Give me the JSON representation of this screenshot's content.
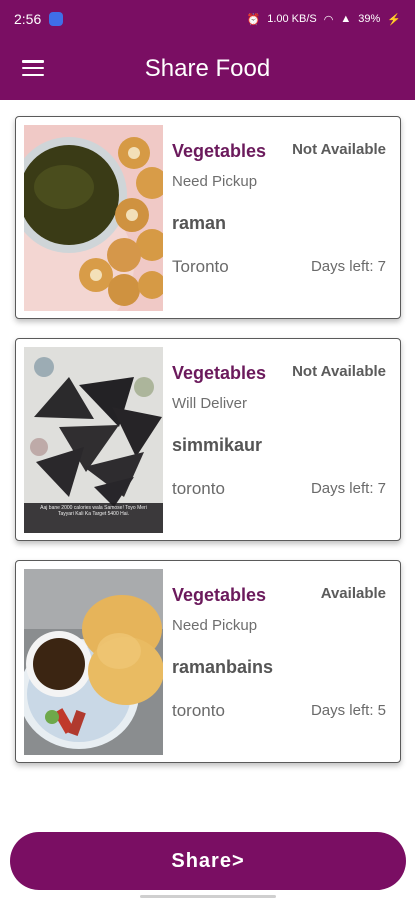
{
  "status": {
    "time": "2:56",
    "net": "1.00 KB/S",
    "battery": "39%"
  },
  "header": {
    "title": "Share Food"
  },
  "posts": [
    {
      "category": "Vegetables",
      "availability": "Not Available",
      "pickup": "Need Pickup",
      "user": "raman",
      "city": "Toronto",
      "days": "Days left: 7"
    },
    {
      "category": "Vegetables",
      "availability": "Not Available",
      "pickup": "Will Deliver",
      "user": "simmikaur",
      "city": "toronto",
      "days": "Days left: 7"
    },
    {
      "category": "Vegetables",
      "availability": "Available",
      "pickup": "Need Pickup",
      "user": "ramanbains",
      "city": "toronto",
      "days": "Days left: 5"
    }
  ],
  "photos": {
    "second_caption": "Aaj bane 2000 calories wala Samose! Toyo Meri Tayyari Kali Ka Target 5400 Hai."
  },
  "share": {
    "label": "Share>"
  },
  "colors": {
    "primary": "#7a0e63",
    "category": "#6b1a5c"
  }
}
